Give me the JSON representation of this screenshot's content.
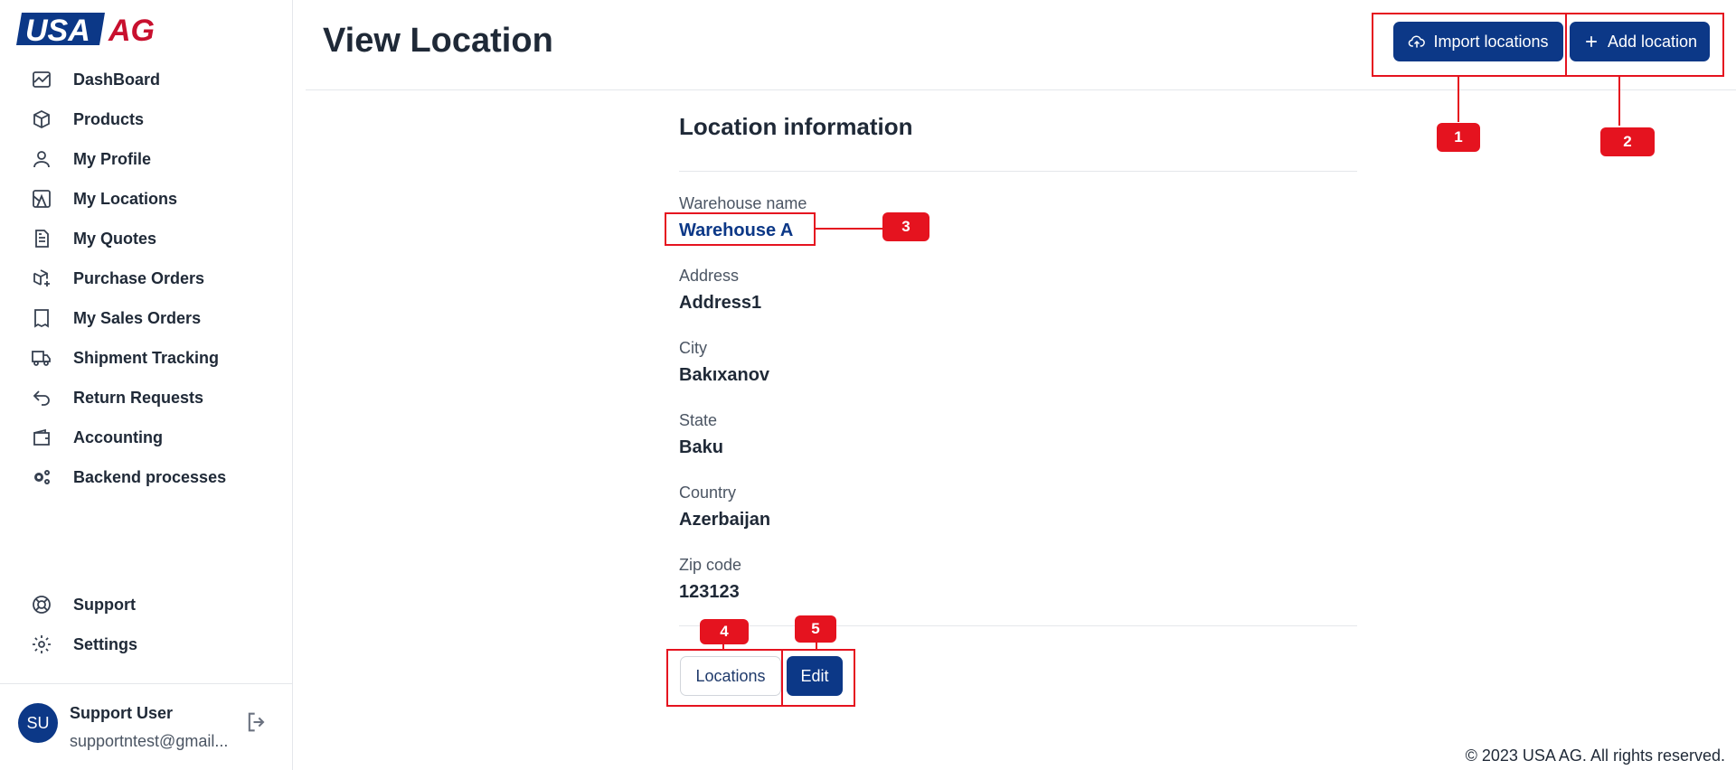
{
  "brand": {
    "name": "USA AG",
    "logo_left": "USA",
    "logo_right": "AG",
    "primary_color": "#0c3887",
    "logo_red": "#c8102e",
    "annotation_color": "#e5131f"
  },
  "sidebar": {
    "items": [
      {
        "label": "DashBoard",
        "icon": "chart-line-icon"
      },
      {
        "label": "Products",
        "icon": "box-icon"
      },
      {
        "label": "My Profile",
        "icon": "user-icon"
      },
      {
        "label": "My Locations",
        "icon": "map-icon"
      },
      {
        "label": "My Quotes",
        "icon": "document-icon"
      },
      {
        "label": "Purchase Orders",
        "icon": "box-plus-icon"
      },
      {
        "label": "My Sales Orders",
        "icon": "receipt-icon"
      },
      {
        "label": "Shipment Tracking",
        "icon": "truck-icon"
      },
      {
        "label": "Return Requests",
        "icon": "undo-icon"
      },
      {
        "label": "Accounting",
        "icon": "wallet-icon"
      },
      {
        "label": "Backend processes",
        "icon": "gears-icon"
      }
    ],
    "bottom_items": [
      {
        "label": "Support",
        "icon": "lifebuoy-icon"
      },
      {
        "label": "Settings",
        "icon": "gear-icon"
      }
    ],
    "user": {
      "initials": "SU",
      "name": "Support User",
      "email": "supportntest@gmail..."
    }
  },
  "header": {
    "title": "View Location",
    "import_label": "Import locations",
    "add_label": "Add location"
  },
  "location": {
    "section_title": "Location information",
    "fields": [
      {
        "label": "Warehouse name",
        "value": "Warehouse A"
      },
      {
        "label": "Address",
        "value": "Address1"
      },
      {
        "label": "City",
        "value": "Bakıxanov"
      },
      {
        "label": "State",
        "value": "Baku"
      },
      {
        "label": "Country",
        "value": "Azerbaijan"
      },
      {
        "label": "Zip code",
        "value": "123123"
      }
    ]
  },
  "actions": {
    "locations_label": "Locations",
    "edit_label": "Edit"
  },
  "footer": {
    "copyright": "© 2023 USA AG. All rights reserved."
  },
  "annotations": [
    "1",
    "2",
    "3",
    "4",
    "5"
  ]
}
